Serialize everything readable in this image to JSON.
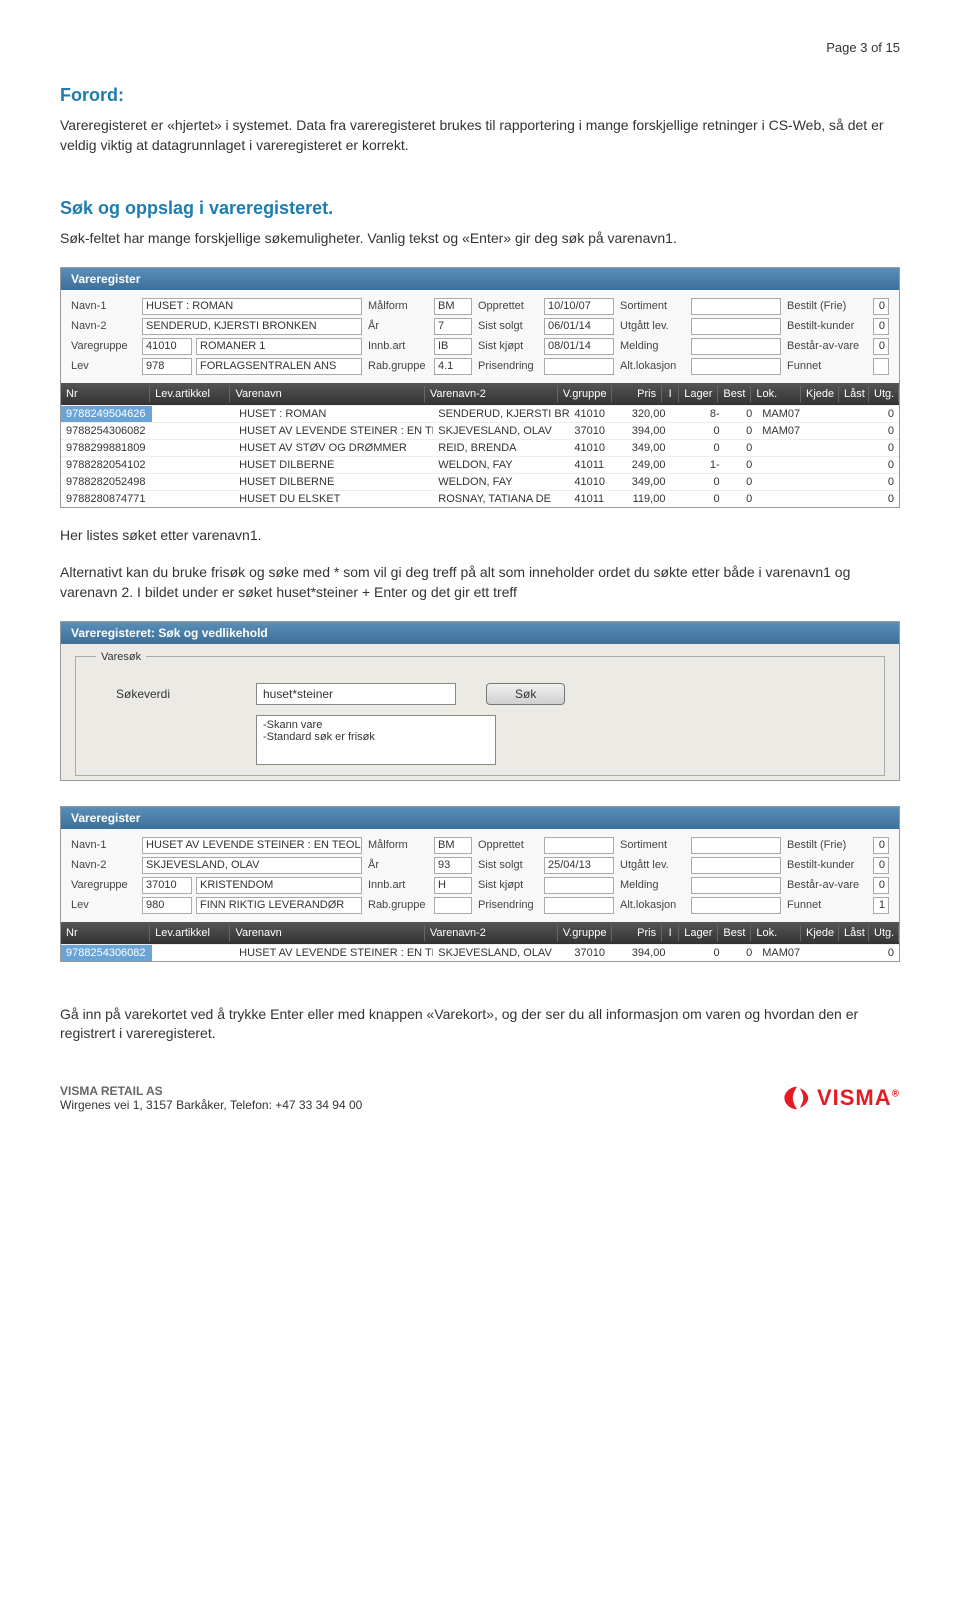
{
  "page_num": "Page 3 of 15",
  "s1_title": "Forord:",
  "s1_p": "Vareregisteret er «hjertet» i systemet. Data fra vareregisteret brukes til rapportering i mange forskjellige retninger i CS-Web, så det er veldig viktig at datagrunnlaget i vareregisteret er korrekt.",
  "s2_title": "Søk og oppslag i vareregisteret.",
  "s2_p": "Søk-feltet har mange forskjellige søkemuligheter. Vanlig tekst og «Enter» gir deg søk på varenavn1.",
  "sc1": {
    "title": "Vareregister",
    "labels": {
      "navn1": "Navn-1",
      "navn2": "Navn-2",
      "vgr": "Varegruppe",
      "lev": "Lev",
      "malform": "Målform",
      "ar": "År",
      "innb": "Innb.art",
      "rab": "Rab.gruppe",
      "oppr": "Opprettet",
      "solgt": "Sist solgt",
      "kjopt": "Sist kjøpt",
      "pris": "Prisendring",
      "sort": "Sortiment",
      "utg": "Utgått lev.",
      "meld": "Melding",
      "alt": "Alt.lokasjon",
      "bfrie": "Bestilt (Frie)",
      "bkund": "Bestilt-kunder",
      "bav": "Består-av-vare",
      "funn": "Funnet"
    },
    "vals": {
      "navn1": "HUSET : ROMAN",
      "navn2": "SENDERUD, KJERSTI BRONKEN",
      "vgr_c": "41010",
      "vgr_t": "ROMANER 1",
      "lev_c": "978",
      "lev_t": "FORLAGSENTRALEN ANS",
      "malform": "BM",
      "ar": "7",
      "innb": "IB",
      "rab": "4.1",
      "oppr": "10/10/07",
      "solgt": "06/01/14",
      "kjopt": "08/01/14",
      "bfrie": "0",
      "bkund": "0",
      "bav": "0"
    },
    "hdr": [
      "Nr",
      "Lev.artikkel",
      "Varenavn",
      "Varenavn-2",
      "V.gruppe",
      "Pris",
      "I",
      "Lager",
      "Best",
      "Lok.",
      "Kjede",
      "Låst",
      "Utg."
    ],
    "rows": [
      {
        "nr": "9788249504626",
        "varn": "HUSET : ROMAN",
        "varn2": "SENDERUD, KJERSTI BRON",
        "vg": "41010",
        "pris": "320,00",
        "lager": "8-",
        "best": "0",
        "lok": "MAM07",
        "utg": "0",
        "sel": true
      },
      {
        "nr": "9788254306082",
        "varn": "HUSET AV LEVENDE STEINER : EN TEOL",
        "varn2": "SKJEVESLAND, OLAV",
        "vg": "37010",
        "pris": "394,00",
        "lager": "0",
        "best": "0",
        "lok": "MAM07",
        "utg": "0"
      },
      {
        "nr": "9788299881809",
        "varn": "HUSET AV STØV OG DRØMMER",
        "varn2": "REID, BRENDA",
        "vg": "41010",
        "pris": "349,00",
        "lager": "0",
        "best": "0",
        "lok": "",
        "utg": "0"
      },
      {
        "nr": "9788282054102",
        "varn": "HUSET DILBERNE",
        "varn2": "WELDON, FAY",
        "vg": "41011",
        "pris": "249,00",
        "lager": "1-",
        "best": "0",
        "lok": "",
        "utg": "0"
      },
      {
        "nr": "9788282052498",
        "varn": "HUSET DILBERNE",
        "varn2": "WELDON, FAY",
        "vg": "41010",
        "pris": "349,00",
        "lager": "0",
        "best": "0",
        "lok": "",
        "utg": "0"
      },
      {
        "nr": "9788280874771",
        "varn": "HUSET DU ELSKET",
        "varn2": "ROSNAY, TATIANA DE",
        "vg": "41011",
        "pris": "119,00",
        "lager": "0",
        "best": "0",
        "lok": "",
        "utg": "0"
      }
    ]
  },
  "mid_p1": "Her listes søket etter varenavn1.",
  "mid_p2": "Alternativt kan du bruke frisøk og søke med * som vil gi deg treff på alt som inneholder ordet du søkte etter både i varenavn1 og varenavn 2. I bildet under er søket huset*steiner + Enter og det gir ett treff",
  "sc2": {
    "title": "Vareregisteret: Søk og vedlikehold",
    "legend": "Varesøk",
    "lbl": "Søkeverdi",
    "val": "huset*steiner",
    "btn": "Søk",
    "list": [
      "-Skann vare",
      "-Standard søk er frisøk"
    ]
  },
  "sc3": {
    "title": "Vareregister",
    "vals": {
      "navn1": "HUSET AV LEVENDE STEINER : EN TEOLOGI FO",
      "navn2": "SKJEVESLAND, OLAV",
      "vgr_c": "37010",
      "vgr_t": "KRISTENDOM",
      "lev_c": "980",
      "lev_t": "FINN RIKTIG LEVERANDØR",
      "malform": "BM",
      "ar": "93",
      "innb": "H",
      "oppr": "",
      "solgt": "25/04/13",
      "kjopt": "",
      "bfrie": "0",
      "bkund": "0",
      "bav": "0",
      "funn": "1"
    },
    "rows": [
      {
        "nr": "9788254306082",
        "varn": "HUSET AV LEVENDE STEINER : EN TEOL",
        "varn2": "SKJEVESLAND, OLAV",
        "vg": "37010",
        "pris": "394,00",
        "lager": "0",
        "best": "0",
        "lok": "MAM07",
        "utg": "0",
        "sel": true
      }
    ]
  },
  "end_p": "Gå inn på varekortet ved å trykke Enter eller med knappen «Varekort», og der ser du all informasjon om varen og hvordan den er registrert i vareregisteret.",
  "footer": {
    "line1": "VISMA RETAIL AS",
    "line2": "Wirgenes vei 1, 3157 Barkåker, Telefon: +47 33 34 94 00",
    "brand": "VISMA"
  }
}
